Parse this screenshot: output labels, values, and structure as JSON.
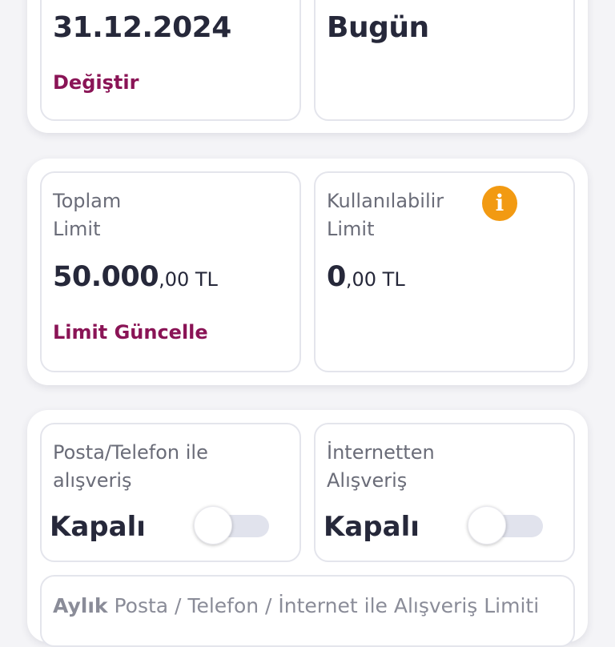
{
  "statement_card": {
    "date": "31.12.2024",
    "change_label": "Değiştir",
    "today_label": "Bugün"
  },
  "limits_card": {
    "total": {
      "label_line1": "Toplam",
      "label_line2": "Limit",
      "amount_int": "50.000",
      "amount_dec": ",00 TL",
      "update_label": "Limit Güncelle"
    },
    "available": {
      "label_line1": "Kullanılabilir",
      "label_line2": "Limit",
      "info_icon": "i",
      "amount_int": "0",
      "amount_dec": ",00 TL"
    }
  },
  "shopping_card": {
    "mail_phone": {
      "label_line1": "Posta/Telefon ile",
      "label_line2": "alışveriş",
      "state": "Kapalı",
      "enabled": false
    },
    "internet": {
      "label_line1": "İnternetten",
      "label_line2": "Alışveriş",
      "state": "Kapalı",
      "enabled": false
    },
    "monthly_limit": {
      "prefix": "Aylık",
      "text": " Posta / Telefon / İnternet ile Alışveriş Limiti"
    }
  },
  "colors": {
    "accent": "#8a1456",
    "info": "#f29a12",
    "toggle_off_track": "#e1e3ed",
    "text_dark": "#26283a",
    "text_muted": "#6a6c78"
  }
}
